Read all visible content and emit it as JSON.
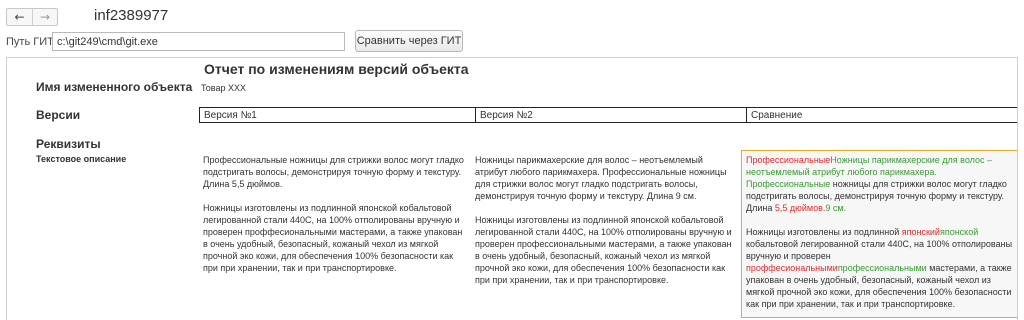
{
  "window": {
    "title": "inf2389977",
    "back_glyph": "←",
    "forward_glyph": "→"
  },
  "git": {
    "label": "Путь ГИТ:",
    "path_value": "c:\\git249\\cmd\\git.exe",
    "compare_button": "Сравнить через ГИТ"
  },
  "report": {
    "title": "Отчет по изменениям версий объекта",
    "object_label": "Имя измененного объекта",
    "object_value": "Товар XXX",
    "versions_label": "Версии",
    "columns": [
      "Версия №1",
      "Версия №2",
      "Сравнение"
    ],
    "attributes_label": "Реквизиты",
    "attribute_name": "Текстовое описание",
    "v1": {
      "p1": "Профессиональные ножницы для стрижки волос могут гладко подстригать волосы, демонстрируя точную форму и текстуру. Длина 5,5 дюймов.",
      "p2": "Ножницы изготовлены из подлинной японской кобальтовой легированной стали 440С, на 100% отполированы вручную и проверен проффесиональными мастерами, а также упакован в очень удобный, безопасный, кожаный чехол из мягкой прочной эко кожи, для обеспечения 100% безопасности как при при хранении, так и при транспортировке."
    },
    "v2": {
      "p1": "Ножницы парикмахерские для волос – неотъемлемый атрибут любого парикмахера. Профессиональные ножницы для стрижки волос могут гладко подстригать волосы, демонстрируя точную форму и текстуру. Длина 9 см.",
      "p2": "Ножницы изготовлены из подлинной японской кобальтовой легированной стали 440С, на 100% отполированы вручную и проверен профессиональными мастерами, а также упакован в очень удобный, безопасный, кожаный чехол из мягкой прочной эко кожи, для обеспечения 100% безопасности как при при хранении, так и при транспортировке."
    },
    "diff": {
      "p1_del": "Профессиональные",
      "p1_ins1": "Ножницы парикмахерские для волос – неотъемлемый атрибут любого парикмахера. Профессиональные",
      "p1_same1": " ножницы для стрижки волос могут гладко подстригать волосы, демонстрируя точную форму и текстуру. Длина ",
      "p1_del2": "5,5 дюймов.",
      "p1_ins2": "9 см.",
      "p2_same1": "Ножницы изготовлены из подлинной ",
      "p2_del1": "японский",
      "p2_ins1": "японской",
      "p2_same2": " кобальтовой легированной стали 440С, на 100% отполированы вручную и проверен ",
      "p2_del2": "проффесиональными",
      "p2_ins2": "профессиональными",
      "p2_same3": " мастерами, а также упакован в очень удобный, безопасный, кожаный чехол из мягкой прочной эко кожи, для обеспечения 100% безопасности как при при хранении, так и при транспортировке."
    },
    "colors": {
      "deleted": "#e02a2a",
      "inserted": "#3a9a33",
      "highlight_border": "#e4ac28"
    }
  }
}
